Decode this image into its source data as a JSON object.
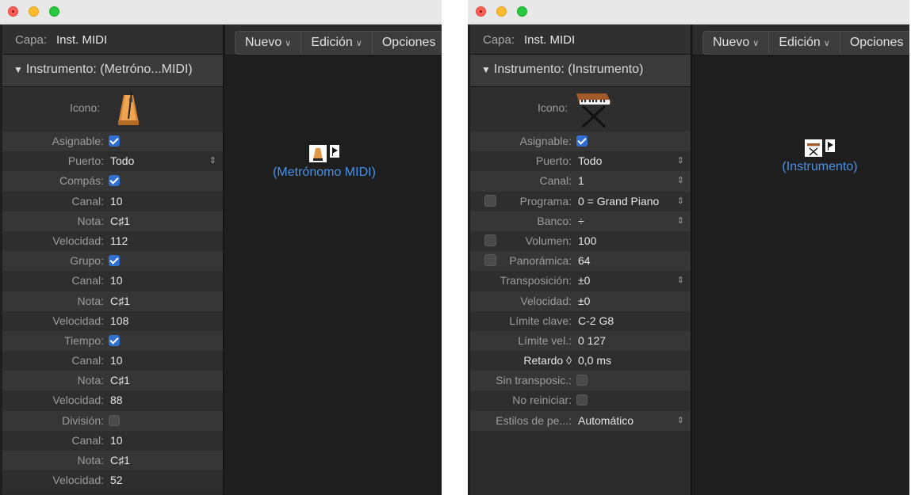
{
  "left": {
    "capa_label": "Capa:",
    "capa_value": "Inst. MIDI",
    "inst_title": "Instrumento: (Metróno...MIDI)",
    "icon_label": "Icono:",
    "icon_name": "metronome-icon",
    "params": [
      {
        "label": "Asignable:",
        "check": "on"
      },
      {
        "label": "Puerto:",
        "value": "Todo",
        "updown": true
      },
      {
        "label": "Compás:",
        "check": "on"
      },
      {
        "label": "Canal:",
        "value": "10"
      },
      {
        "label": "Nota:",
        "value": "C♯1"
      },
      {
        "label": "Velocidad:",
        "value": "112"
      },
      {
        "label": "Grupo:",
        "check": "on"
      },
      {
        "label": "Canal:",
        "value": "10"
      },
      {
        "label": "Nota:",
        "value": "C♯1"
      },
      {
        "label": "Velocidad:",
        "value": "108"
      },
      {
        "label": "Tiempo:",
        "check": "on"
      },
      {
        "label": "Canal:",
        "value": "10"
      },
      {
        "label": "Nota:",
        "value": "C♯1"
      },
      {
        "label": "Velocidad:",
        "value": "88"
      },
      {
        "label": "División:",
        "check": "off"
      },
      {
        "label": "Canal:",
        "value": "10"
      },
      {
        "label": "Nota:",
        "value": "C♯1"
      },
      {
        "label": "Velocidad:",
        "value": "52"
      }
    ],
    "toolbar": {
      "nuevo": "Nuevo",
      "edicion": "Edición",
      "opciones": "Opciones"
    },
    "object_label": "(Metrónomo MIDI)"
  },
  "right": {
    "capa_label": "Capa:",
    "capa_value": "Inst. MIDI",
    "inst_title": "Instrumento: (Instrumento)",
    "icon_label": "Icono:",
    "icon_name": "keyboard-synth-icon",
    "params": [
      {
        "label": "Asignable:",
        "check": "on"
      },
      {
        "label": "Puerto:",
        "value": "Todo",
        "updown": true
      },
      {
        "label": "Canal:",
        "value": "1",
        "updown": true
      },
      {
        "label": "Programa:",
        "value": "0 = Grand Piano",
        "updown": true,
        "leftcheck": true
      },
      {
        "label": "Banco:",
        "value": "÷",
        "updown": true
      },
      {
        "label": "Volumen:",
        "value": "100",
        "leftcheck": true
      },
      {
        "label": "Panorámica:",
        "value": "64",
        "leftcheck": true
      },
      {
        "label": "Transposición:",
        "value": "±0",
        "updown": true
      },
      {
        "label": "Velocidad:",
        "value": "±0"
      },
      {
        "label": "Límite clave:",
        "value": "C-2      G8"
      },
      {
        "label": "Límite vel.:",
        "value": "0     127"
      },
      {
        "label": "Retardo ◊",
        "value": "0,0 ms",
        "bright": true
      },
      {
        "label": "Sin transposic.:",
        "check": "off"
      },
      {
        "label": "No reiniciar:",
        "check": "off"
      },
      {
        "label": "Estilos de pe...:",
        "value": "Automático",
        "updown": true
      }
    ],
    "toolbar": {
      "nuevo": "Nuevo",
      "edicion": "Edición",
      "opciones": "Opciones"
    },
    "object_label": "(Instrumento)"
  },
  "colors": {
    "accent": "#2f6fd0",
    "object_label": "#4b91e6"
  }
}
